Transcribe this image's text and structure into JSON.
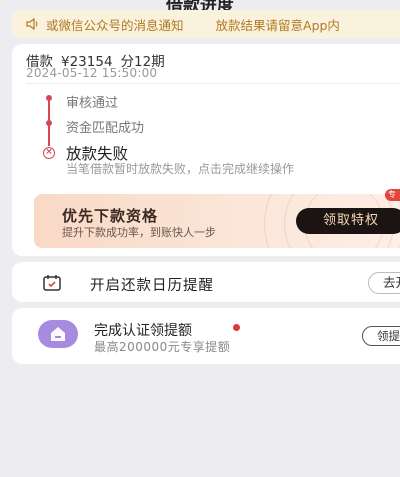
{
  "page": {
    "title": "借款进度"
  },
  "notice": {
    "text1": "或微信公众号的消息通知",
    "text2": "放款结果请留意App内"
  },
  "loan": {
    "label": "借款",
    "amount": "¥23154",
    "term": "分12期",
    "time": "2024-05-12 15:50:00"
  },
  "steps": [
    {
      "label": "审核通过"
    },
    {
      "label": "资金匹配成功"
    }
  ],
  "failure": {
    "title": "放款失败",
    "desc": "当笔借款暂时放款失败，点击完成继续操作"
  },
  "priority": {
    "title": "优先下款资格",
    "subtitle": "提升下款成功率，到账快人一步",
    "button": "领取特权",
    "badge": "专"
  },
  "calendar": {
    "label": "开启还款日历提醒",
    "button": "去开"
  },
  "cert": {
    "title": "完成认证领提额",
    "subtitle": "最高200000元专享提额",
    "button": "领提"
  },
  "colors": {
    "accent": "#d94852",
    "notice_bg": "#fbf2de",
    "notice_text": "#b07a22",
    "dark_button": "#1c1412",
    "icon_purple": "#a68be0"
  }
}
